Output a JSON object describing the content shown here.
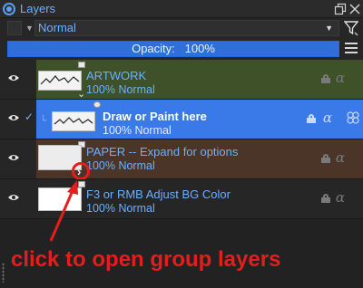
{
  "window": {
    "title": "Layers",
    "icon": "layers-icon",
    "buttons": [
      "restore-icon",
      "close-icon"
    ]
  },
  "blend": {
    "mode": "Normal",
    "filter_icon": "filter-icon"
  },
  "opacity": {
    "label": "Opacity:",
    "value_text": "100%",
    "value": 1.0
  },
  "layers": [
    {
      "name": "ARTWORK",
      "sub": "100% Normal",
      "type": "group",
      "expanded": true,
      "color": "#3e5129",
      "visible": true
    },
    {
      "name": "Draw or Paint here",
      "sub": "100% Normal",
      "type": "layer",
      "selected": true,
      "color": "#3a79e8",
      "visible": true
    },
    {
      "name": "PAPER -- Expand for options",
      "sub": "100% Normal",
      "type": "group",
      "expanded": false,
      "color": "#4b3529",
      "visible": true
    },
    {
      "name": "F3 or RMB Adjust BG Color",
      "sub": "100% Normal",
      "type": "layer",
      "color": "#262626",
      "visible": true
    }
  ],
  "annotation": {
    "text": "click to open group layers",
    "color": "#e41d1d"
  },
  "colors": {
    "accent": "#6bb0ff",
    "selected": "#3a79e8",
    "annotation": "#e41d1d"
  }
}
